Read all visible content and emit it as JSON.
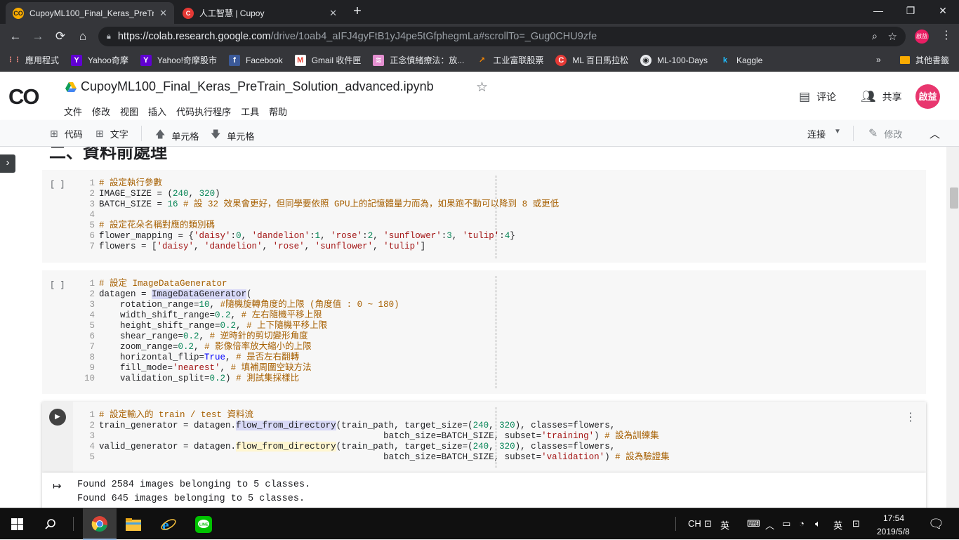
{
  "browser": {
    "tabs": [
      {
        "title": "CupoyML100_Final_Keras_PreTr",
        "icon": "colab-icon",
        "icon_text": "CO",
        "active": true
      },
      {
        "title": "人工智慧 | Cupoy",
        "icon": "cupoy-icon",
        "icon_text": "C",
        "active": false
      }
    ],
    "tab_close": "✕",
    "new_tab": "+",
    "window_controls": {
      "minimize": "—",
      "restore": "❐",
      "close": "✕"
    },
    "url_host": "https://colab.research.google.com",
    "url_path": "/drive/1oab4_aIFJ4gyFtB1yJ4pe5tGfphegmLa#scrollTo=_Gug0CHU9zfe",
    "profile_text": "啟益"
  },
  "bookmarks": {
    "items": [
      {
        "label": "應用程式",
        "icon": "apps-icon",
        "icon_text": "⋮⋮",
        "color": "#f28b82"
      },
      {
        "label": "Yahoo奇摩",
        "icon": "yahoo-icon",
        "icon_text": "Y",
        "color": "#6001d2"
      },
      {
        "label": "Yahoo!奇摩股市",
        "icon": "yahoo-icon",
        "icon_text": "Y",
        "color": "#6001d2"
      },
      {
        "label": "Facebook",
        "icon": "facebook-icon",
        "icon_text": "f",
        "color": "#3b5998"
      },
      {
        "label": "Gmail 收件匣",
        "icon": "gmail-icon",
        "icon_text": "M",
        "color": "#ea4335"
      },
      {
        "label": "正念憤緒療法：放...",
        "icon": "pattern-icon",
        "icon_text": "≋",
        "color": "#e38fd0"
      },
      {
        "label": "工业富联股票",
        "icon": "chart-icon",
        "icon_text": "↗",
        "color": "#ff8a00"
      },
      {
        "label": "ML 百日馬拉松",
        "icon": "cupoy-icon",
        "icon_text": "C",
        "color": "#e53935"
      },
      {
        "label": "ML-100-Days",
        "icon": "github-icon",
        "icon_text": "◉",
        "color": "#35363a"
      },
      {
        "label": "Kaggle",
        "icon": "kaggle-icon",
        "icon_text": "k",
        "color": "#35363a"
      }
    ],
    "more": "»",
    "other": "其他書籤"
  },
  "colab": {
    "logo": "CO",
    "notebook_title": "CupoyML100_Final_Keras_PreTrain_Solution_advanced.ipynb",
    "menu": [
      "文件",
      "修改",
      "视图",
      "插入",
      "代码执行程序",
      "工具",
      "帮助"
    ],
    "comment_label": "评论",
    "share_label": "共享",
    "avatar_text": "啟益"
  },
  "toolbar": {
    "add_code": "代码",
    "add_text": "文字",
    "cell_up": "单元格",
    "cell_down": "单元格",
    "connect": "连接",
    "edit": "修改"
  },
  "notebook": {
    "heading_partial": "二、資料前處理",
    "cells": [
      {
        "exec": "[ ]",
        "lines": [
          [
            [
              "c",
              "# 設定執行參數"
            ]
          ],
          [
            [
              "",
              "IMAGE_SIZE = ("
            ],
            [
              "n",
              "240"
            ],
            [
              "",
              ", "
            ],
            [
              "n",
              "320"
            ],
            [
              "",
              ")"
            ]
          ],
          [
            [
              "",
              "BATCH_SIZE = "
            ],
            [
              "n",
              "16"
            ],
            [
              "c",
              " # 設 32 效果會更好，但同學要依照 GPU上的記憶體量力而為，如果跑不動可以降到 8 或更低"
            ]
          ],
          [
            [
              "",
              ""
            ]
          ],
          [
            [
              "c",
              "# 設定花朵名稱對應的類別碼"
            ]
          ],
          [
            [
              "",
              "flower_mapping = {"
            ],
            [
              "s",
              "'daisy'"
            ],
            [
              "",
              ":"
            ],
            [
              "n",
              "0"
            ],
            [
              "",
              ", "
            ],
            [
              "s",
              "'dandelion'"
            ],
            [
              "",
              ":"
            ],
            [
              "n",
              "1"
            ],
            [
              "",
              ", "
            ],
            [
              "s",
              "'rose'"
            ],
            [
              "",
              ":"
            ],
            [
              "n",
              "2"
            ],
            [
              "",
              ", "
            ],
            [
              "s",
              "'sunflower'"
            ],
            [
              "",
              ":"
            ],
            [
              "n",
              "3"
            ],
            [
              "",
              ", "
            ],
            [
              "s",
              "'tulip'"
            ],
            [
              "",
              ":"
            ],
            [
              "n",
              "4"
            ],
            [
              "",
              "}"
            ]
          ],
          [
            [
              "",
              "flowers = ["
            ],
            [
              "s",
              "'daisy'"
            ],
            [
              "",
              ", "
            ],
            [
              "s",
              "'dandelion'"
            ],
            [
              "",
              ", "
            ],
            [
              "s",
              "'rose'"
            ],
            [
              "",
              ", "
            ],
            [
              "s",
              "'sunflower'"
            ],
            [
              "",
              ", "
            ],
            [
              "s",
              "'tulip'"
            ],
            [
              "",
              "]"
            ]
          ]
        ]
      },
      {
        "exec": "[ ]",
        "lines": [
          [
            [
              "c",
              "# 設定 ImageDataGenerator"
            ]
          ],
          [
            [
              "",
              "datagen = "
            ],
            [
              "hl",
              "ImageDataGenerator"
            ],
            [
              "",
              "("
            ]
          ],
          [
            [
              "",
              "    rotation_range="
            ],
            [
              "n",
              "10"
            ],
            [
              "",
              ", "
            ],
            [
              "c",
              "#隨機旋轉角度的上限 (角度值 : 0 ~ 180)"
            ]
          ],
          [
            [
              "",
              "    width_shift_range="
            ],
            [
              "n",
              "0.2"
            ],
            [
              "",
              ", "
            ],
            [
              "c",
              "# 左右隨機平移上限"
            ]
          ],
          [
            [
              "",
              "    height_shift_range="
            ],
            [
              "n",
              "0.2"
            ],
            [
              "",
              ", "
            ],
            [
              "c",
              "# 上下隨機平移上限"
            ]
          ],
          [
            [
              "",
              "    shear_range="
            ],
            [
              "n",
              "0.2"
            ],
            [
              "",
              ", "
            ],
            [
              "c",
              "# 逆時針的剪切變形角度"
            ]
          ],
          [
            [
              "",
              "    zoom_range="
            ],
            [
              "n",
              "0.2"
            ],
            [
              "",
              ", "
            ],
            [
              "c",
              "# 影像倍率放大縮小的上限"
            ]
          ],
          [
            [
              "",
              "    horizontal_flip="
            ],
            [
              "k",
              "True"
            ],
            [
              "",
              ", "
            ],
            [
              "c",
              "# 是否左右翻轉"
            ]
          ],
          [
            [
              "",
              "    fill_mode="
            ],
            [
              "s",
              "'nearest'"
            ],
            [
              "",
              ", "
            ],
            [
              "c",
              "# 填補周圍空缺方法"
            ]
          ],
          [
            [
              "",
              "    validation_split="
            ],
            [
              "n",
              "0.2"
            ],
            [
              "",
              ") "
            ],
            [
              "c",
              "# 測試集採樣比"
            ]
          ]
        ]
      },
      {
        "exec": "▶",
        "lines": [
          [
            [
              "c",
              "# 設定輸入的 train / test 資料流"
            ]
          ],
          [
            [
              "",
              "train_generator = datagen."
            ],
            [
              "hl",
              "flow_from_directory"
            ],
            [
              "",
              "(train_path, target_size=("
            ],
            [
              "n",
              "240"
            ],
            [
              "",
              ", "
            ],
            [
              "n",
              "320"
            ],
            [
              "",
              "), classes=flowers,"
            ]
          ],
          [
            [
              "",
              "                                                      batch_size=BATCH_SIZE, subset="
            ],
            [
              "s",
              "'training'"
            ],
            [
              "",
              ") "
            ],
            [
              "c",
              "# 設為訓練集"
            ]
          ],
          [
            [
              "",
              "valid_generator = datagen."
            ],
            [
              "hl2",
              "flow_from_directory"
            ],
            [
              "",
              "(train_path, target_size=("
            ],
            [
              "n",
              "240"
            ],
            [
              "",
              ", "
            ],
            [
              "n",
              "320"
            ],
            [
              "",
              "), classes=flowers,"
            ]
          ],
          [
            [
              "",
              "                                                      batch_size=BATCH_SIZE, subset="
            ],
            [
              "s",
              "'validation'"
            ],
            [
              "",
              ") "
            ],
            [
              "c",
              "# 設為驗證集"
            ]
          ]
        ],
        "output": [
          "Found 2584 images belonging to 5 classes.",
          "Found 645 images belonging to 5 classes."
        ]
      }
    ]
  },
  "taskbar": {
    "apps": [
      {
        "name": "start-icon"
      },
      {
        "name": "search-icon"
      },
      {
        "name": "chrome-icon",
        "active": true
      },
      {
        "name": "file-explorer-icon"
      },
      {
        "name": "ie-icon"
      },
      {
        "name": "line-icon"
      }
    ],
    "tray_lang": "CH",
    "tray_ime1": "英",
    "tray_ime2": "英",
    "time": "17:54",
    "date": "2019/5/8"
  }
}
